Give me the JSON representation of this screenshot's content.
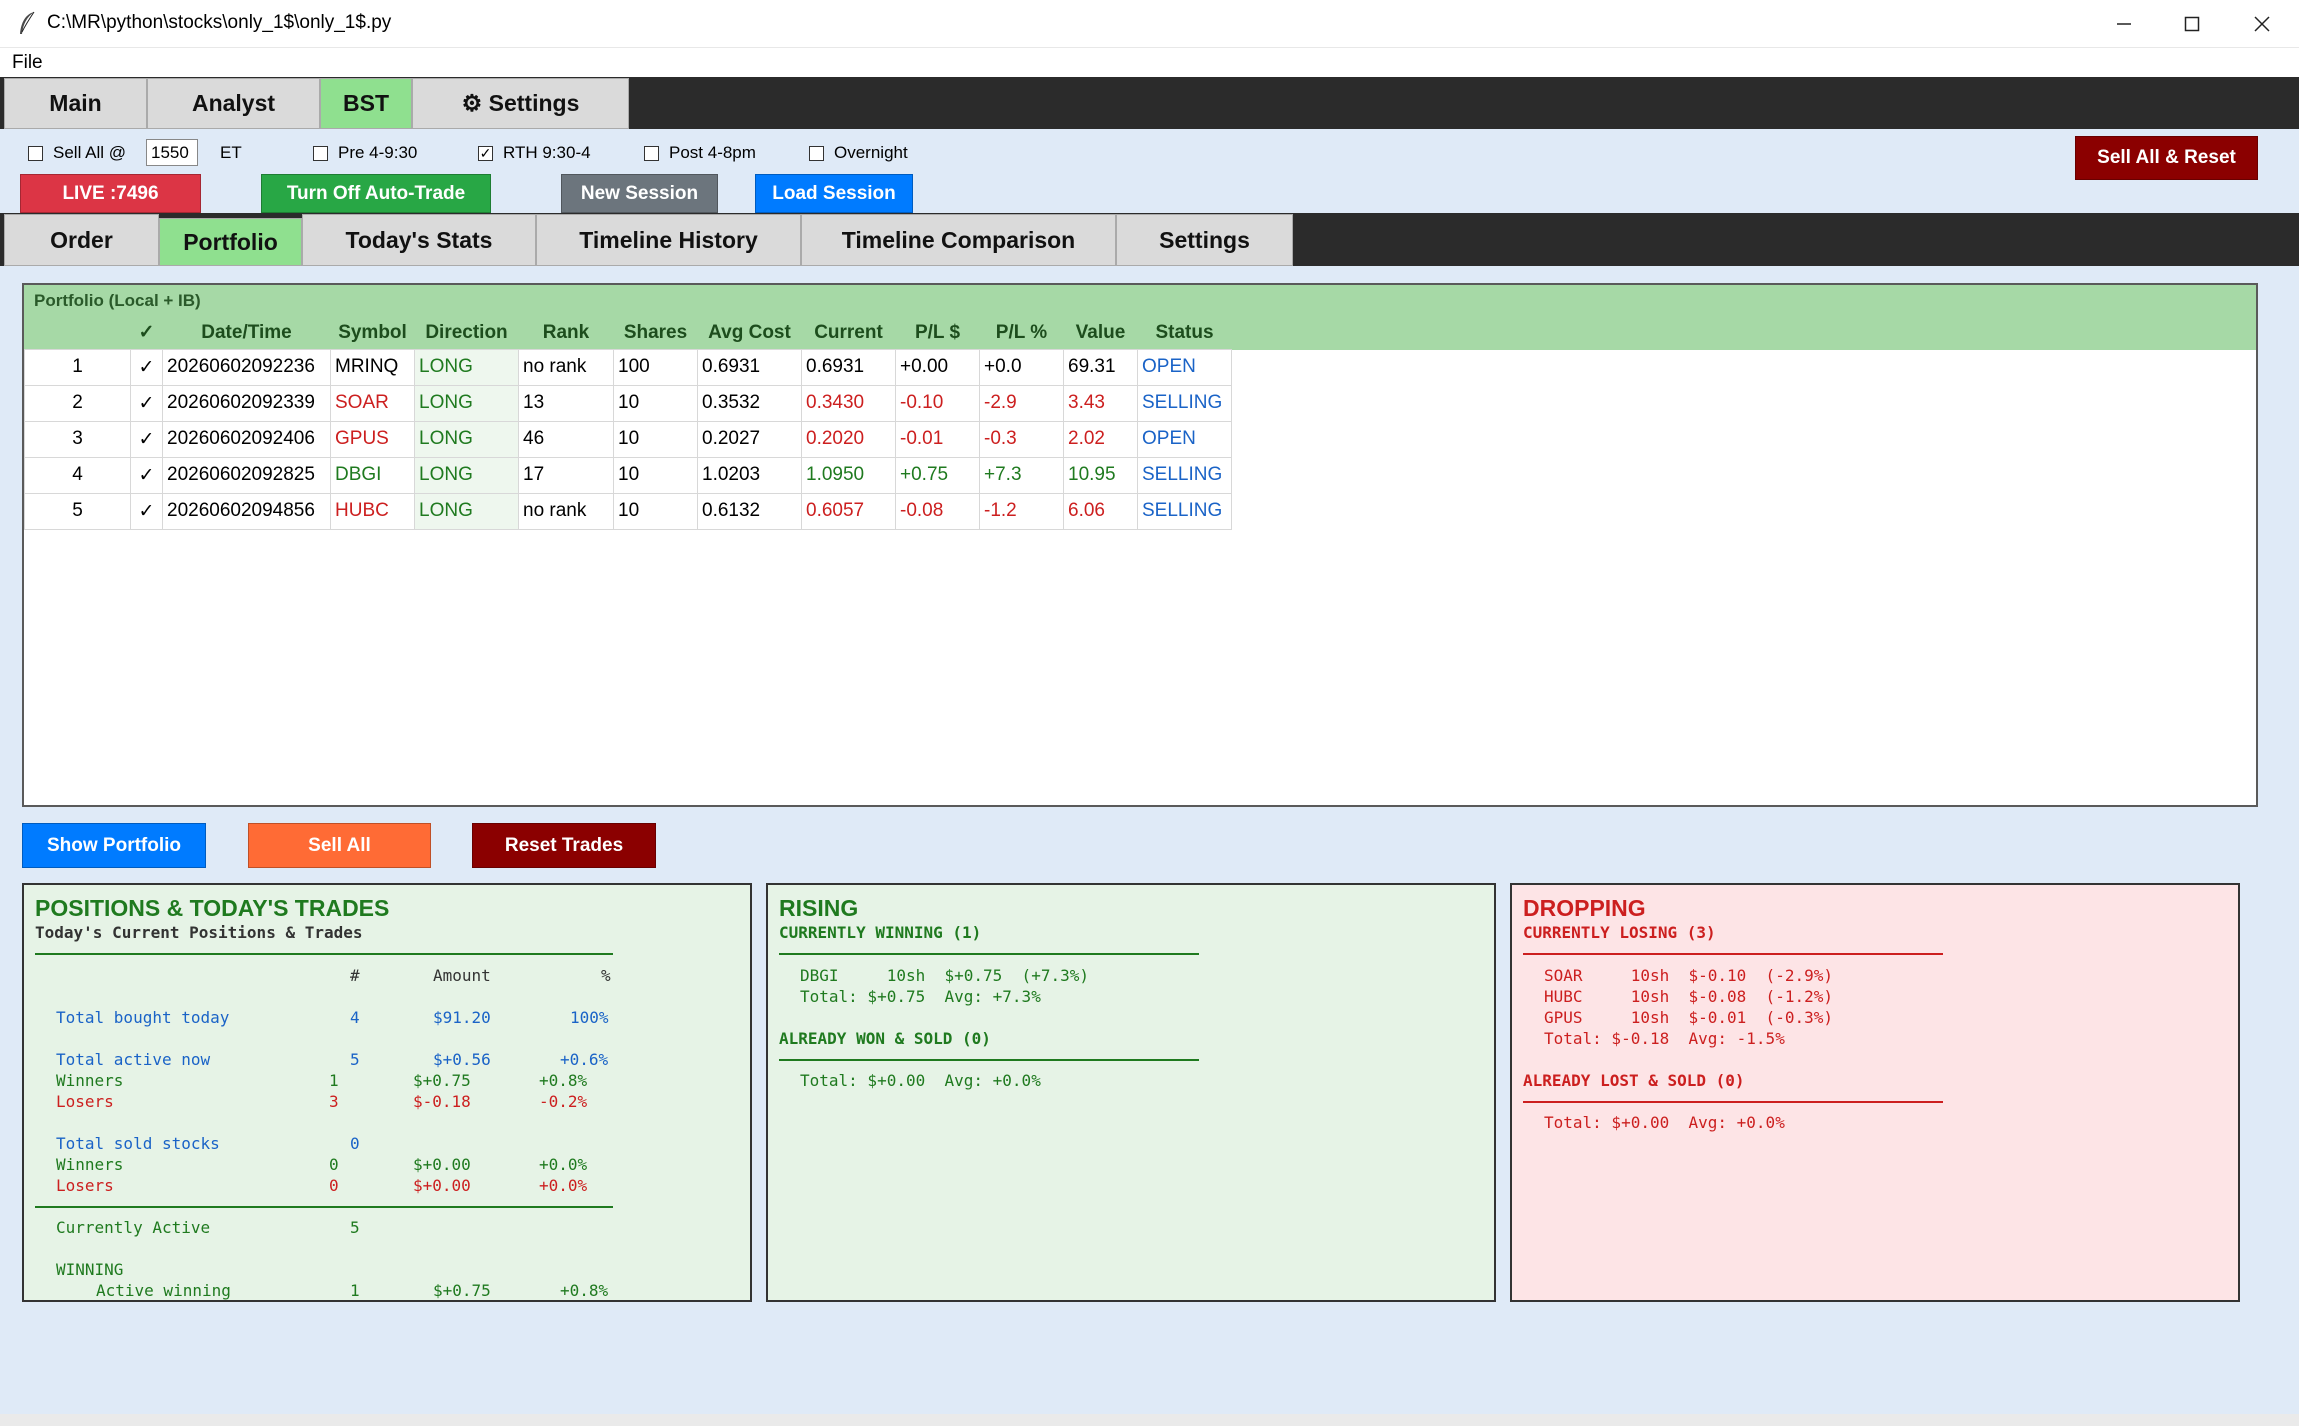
{
  "window": {
    "title": "C:\\MR\\python\\stocks\\only_1$\\only_1$.py"
  },
  "menu": {
    "file": "File"
  },
  "main_tabs": [
    {
      "label": "Main"
    },
    {
      "label": "Analyst"
    },
    {
      "label": "BST"
    },
    {
      "label": "⚙ Settings"
    }
  ],
  "controls": {
    "sell_all_at": "Sell All @",
    "sell_time": "1550",
    "et": "ET",
    "pre": "Pre 4-9:30",
    "rth": "RTH 9:30-4",
    "post": "Post 4-8pm",
    "overnight": "Overnight",
    "rth_checked": "✓",
    "live_btn": "LIVE :7496",
    "autotrade_btn": "Turn Off Auto-Trade",
    "new_session_btn": "New Session",
    "load_session_btn": "Load Session",
    "sell_reset_btn": "Sell All & Reset"
  },
  "sub_tabs": [
    {
      "label": "Order"
    },
    {
      "label": "Portfolio"
    },
    {
      "label": "Today's Stats"
    },
    {
      "label": "Timeline History"
    },
    {
      "label": "Timeline Comparison"
    },
    {
      "label": "Settings"
    }
  ],
  "portfolio": {
    "title": "Portfolio (Local + IB)",
    "headers": [
      "",
      "✓",
      "Date/Time",
      "Symbol",
      "Direction",
      "Rank",
      "Shares",
      "Avg Cost",
      "Current",
      "P/L $",
      "P/L %",
      "Value",
      "Status"
    ],
    "rows": [
      {
        "n": "1",
        "check": "✓",
        "dt": "20260602092236",
        "sym": "MRINQ",
        "dir": "LONG",
        "rank": "no rank",
        "shares": "100",
        "avg": "0.6931",
        "cur": "0.6931",
        "pl": "+0.00",
        "plp": "+0.0",
        "val": "69.31",
        "status": "OPEN"
      },
      {
        "n": "2",
        "check": "✓",
        "dt": "20260602092339",
        "sym": "SOAR",
        "dir": "LONG",
        "rank": "13",
        "shares": "10",
        "avg": "0.3532",
        "cur": "0.3430",
        "pl": "-0.10",
        "plp": "-2.9",
        "val": "3.43",
        "status": "SELLING"
      },
      {
        "n": "3",
        "check": "✓",
        "dt": "20260602092406",
        "sym": "GPUS",
        "dir": "LONG",
        "rank": "46",
        "shares": "10",
        "avg": "0.2027",
        "cur": "0.2020",
        "pl": "-0.01",
        "plp": "-0.3",
        "val": "2.02",
        "status": "OPEN"
      },
      {
        "n": "4",
        "check": "✓",
        "dt": "20260602092825",
        "sym": "DBGI",
        "dir": "LONG",
        "rank": "17",
        "shares": "10",
        "avg": "1.0203",
        "cur": "1.0950",
        "pl": "+0.75",
        "plp": "+7.3",
        "val": "10.95",
        "status": "SELLING"
      },
      {
        "n": "5",
        "check": "✓",
        "dt": "20260602094856",
        "sym": "HUBC",
        "dir": "LONG",
        "rank": "no rank",
        "shares": "10",
        "avg": "0.6132",
        "cur": "0.6057",
        "pl": "-0.08",
        "plp": "-1.2",
        "val": "6.06",
        "status": "SELLING"
      }
    ]
  },
  "actions": {
    "show_portfolio": "Show Portfolio",
    "sell_all": "Sell All",
    "reset_trades": "Reset Trades"
  },
  "positions": {
    "title": "POSITIONS & TODAY'S TRADES",
    "subtitle": "Today's Current Positions & Trades",
    "hdr_num": "#",
    "hdr_amount": "Amount",
    "hdr_pct": "%",
    "bought_label": "Total bought today",
    "bought_n": "4",
    "bought_amt": "$91.20",
    "bought_pct": "100%",
    "active_label": "Total active now",
    "active_n": "5",
    "active_amt": "$+0.56",
    "active_pct": "+0.6%",
    "aw_label": "Winners",
    "aw_n": "1",
    "aw_amt": "$+0.75",
    "aw_pct": "+0.8%",
    "al_label": "Losers",
    "al_n": "3",
    "al_amt": "$-0.18",
    "al_pct": "-0.2%",
    "sold_label": "Total sold stocks",
    "sold_n": "0",
    "sw_label": "Winners",
    "sw_n": "0",
    "sw_amt": "$+0.00",
    "sw_pct": "+0.0%",
    "sl_label": "Losers",
    "sl_n": "0",
    "sl_amt": "$+0.00",
    "sl_pct": "+0.0%",
    "ca_label": "Currently Active",
    "ca_n": "5",
    "winning_label": "WINNING",
    "aw2_label": "Active winning",
    "aw2_n": "1",
    "aw2_amt": "$+0.75",
    "aw2_pct": "+0.8%"
  },
  "rising": {
    "title": "RISING",
    "cur_win": "CURRENTLY WINNING (1)",
    "line1": "DBGI     10sh  $+0.75  (+7.3%)",
    "total1": "Total: $+0.75  Avg: +7.3%",
    "won_sold": "ALREADY WON & SOLD (0)",
    "total2": "Total: $+0.00  Avg: +0.0%"
  },
  "dropping": {
    "title": "DROPPING",
    "cur_lose": "CURRENTLY LOSING (3)",
    "line1": "SOAR     10sh  $-0.10  (-2.9%)",
    "line2": "HUBC     10sh  $-0.08  (-1.2%)",
    "line3": "GPUS     10sh  $-0.01  (-0.3%)",
    "total1": "Total: $-0.18  Avg: -1.5%",
    "lost_sold": "ALREADY LOST & SOLD (0)",
    "total2": "Total: $+0.00  Avg: +0.0%"
  },
  "colors": {
    "green": "#1f7a1f",
    "red": "#cc1f1f",
    "blue": "#1a63c7",
    "tab_active": "#8fe08f"
  }
}
